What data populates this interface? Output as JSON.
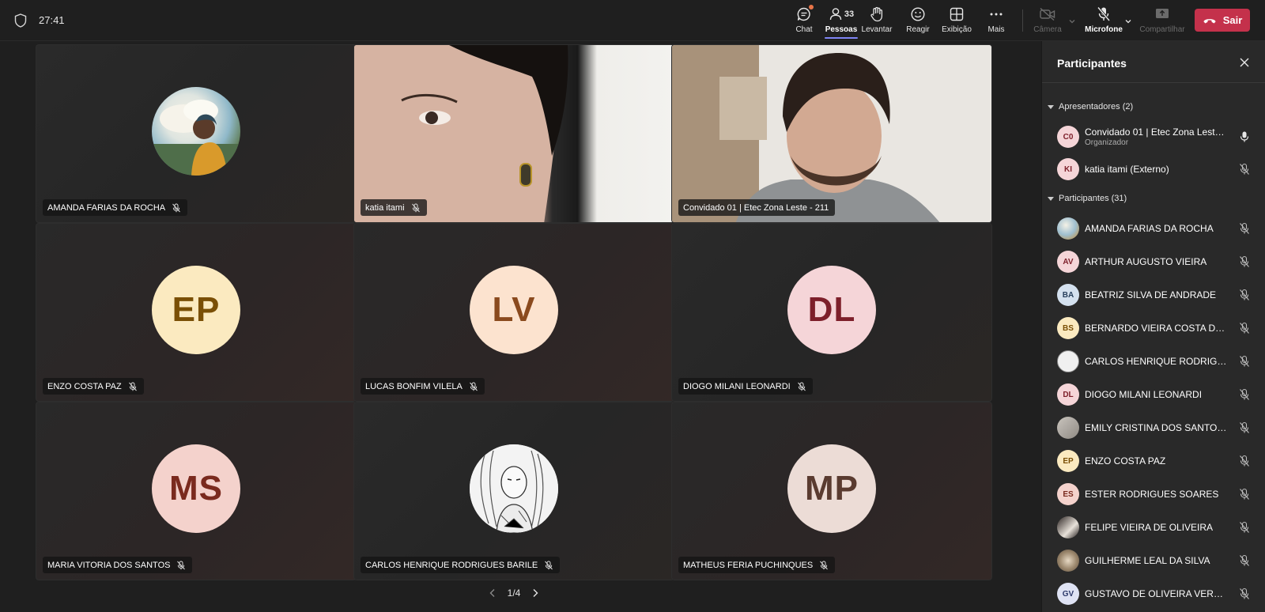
{
  "header": {
    "timer": "27:41",
    "buttons": {
      "chat": "Chat",
      "people": "Pessoas",
      "people_count": "33",
      "raise": "Levantar",
      "react": "Reagir",
      "view": "Exibição",
      "more": "Mais",
      "camera": "Câmera",
      "mic": "Microfone",
      "share": "Compartilhar"
    },
    "leave": "Sair"
  },
  "grid": {
    "tiles": [
      {
        "name": "AMANDA FARIAS DA ROCHA"
      },
      {
        "name": "katia itami"
      },
      {
        "name": "Convidado 01 | Etec Zona Leste - 211"
      },
      {
        "name": "ENZO COSTA PAZ",
        "initials": "EP"
      },
      {
        "name": "LUCAS BONFIM VILELA",
        "initials": "LV"
      },
      {
        "name": "DIOGO MILANI LEONARDI",
        "initials": "DL"
      },
      {
        "name": "MARIA VITORIA DOS SANTOS",
        "initials": "MS"
      },
      {
        "name": "CARLOS HENRIQUE RODRIGUES BARILE"
      },
      {
        "name": "MATHEUS FERIA PUCHINQUES",
        "initials": "MP"
      }
    ],
    "pager": "1/4"
  },
  "panel": {
    "title": "Participantes",
    "presenters_label": "Apresentadores (2)",
    "presenters": [
      {
        "initials": "C0",
        "name": "Convidado 01 | Etec Zona Leste - 211",
        "role": "Organizador"
      },
      {
        "initials": "KI",
        "name": "katia itami (Externo)"
      }
    ],
    "participants_label": "Participantes (31)",
    "participants": [
      {
        "initials": "",
        "name": "AMANDA FARIAS DA ROCHA"
      },
      {
        "initials": "AV",
        "name": "ARTHUR AUGUSTO VIEIRA"
      },
      {
        "initials": "BA",
        "name": "BEATRIZ SILVA DE ANDRADE"
      },
      {
        "initials": "BS",
        "name": "BERNARDO VIEIRA COSTA DOS SANTOS"
      },
      {
        "initials": "",
        "name": "CARLOS HENRIQUE RODRIGUES BARILE"
      },
      {
        "initials": "DL",
        "name": "DIOGO MILANI LEONARDI"
      },
      {
        "initials": "",
        "name": "EMILY CRISTINA DOS SANTOS SILVA"
      },
      {
        "initials": "EP",
        "name": "ENZO COSTA PAZ"
      },
      {
        "initials": "ES",
        "name": "ESTER RODRIGUES SOARES"
      },
      {
        "initials": "",
        "name": "FELIPE VIEIRA DE OLIVEIRA"
      },
      {
        "initials": "",
        "name": "GUILHERME LEAL DA SILVA"
      },
      {
        "initials": "GV",
        "name": "GUSTAVO DE OLIVEIRA VEROLLI"
      }
    ]
  }
}
